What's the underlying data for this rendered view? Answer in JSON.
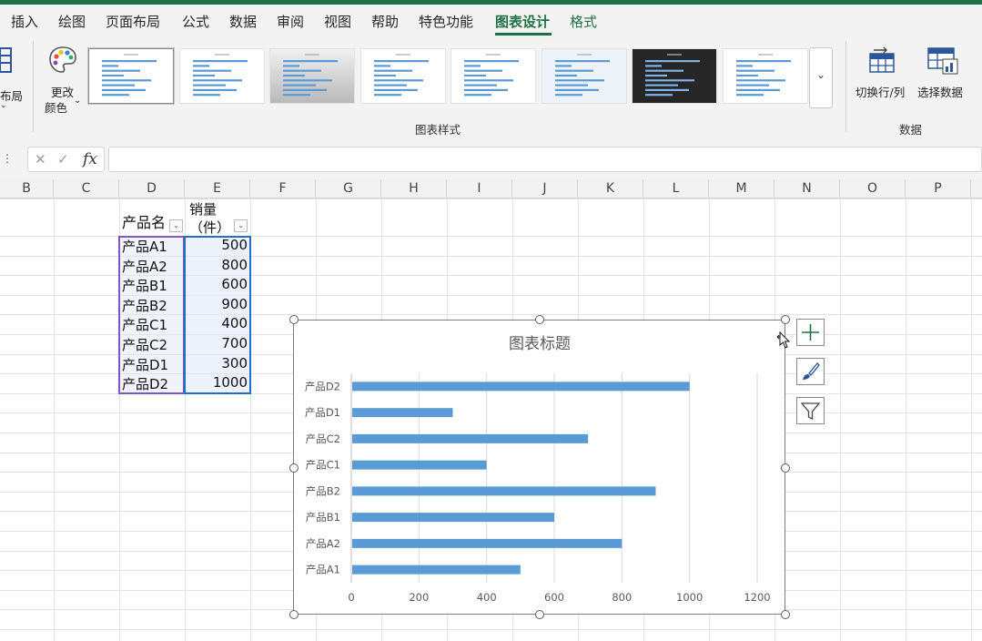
{
  "ribbon_tabs": [
    {
      "label": "插入",
      "state": "normal"
    },
    {
      "label": "绘图",
      "state": "normal"
    },
    {
      "label": "页面布局",
      "state": "normal"
    },
    {
      "label": "公式",
      "state": "normal"
    },
    {
      "label": "数据",
      "state": "normal"
    },
    {
      "label": "审阅",
      "state": "normal"
    },
    {
      "label": "视图",
      "state": "normal"
    },
    {
      "label": "帮助",
      "state": "normal"
    },
    {
      "label": "特色功能",
      "state": "normal"
    },
    {
      "label": "图表设计",
      "state": "active"
    },
    {
      "label": "格式",
      "state": "contextual"
    }
  ],
  "ribbon": {
    "layout_label": "布局",
    "change_colors_line1": "更改",
    "change_colors_line2": "颜色",
    "styles_group_label": "图表样式",
    "switch_row_col_label": "切换行/列",
    "select_data_label": "选择数据",
    "data_group_label": "数据",
    "gallery_count": 8,
    "selected_style_index": 0
  },
  "formula_bar": {
    "cancel_glyph": "✕",
    "enter_glyph": "✓",
    "fx_label": "fx",
    "value": ""
  },
  "columns": [
    "B",
    "C",
    "D",
    "E",
    "F",
    "G",
    "H",
    "I",
    "J",
    "K",
    "L",
    "M",
    "N",
    "O",
    "P"
  ],
  "table": {
    "header_product": "产品名",
    "header_sales_line1": "销量",
    "header_sales_line2": "（件）",
    "rows": [
      {
        "product": "产品A1",
        "sales": "500"
      },
      {
        "product": "产品A2",
        "sales": "800"
      },
      {
        "product": "产品B1",
        "sales": "600"
      },
      {
        "product": "产品B2",
        "sales": "900"
      },
      {
        "product": "产品C1",
        "sales": "400"
      },
      {
        "product": "产品C2",
        "sales": "700"
      },
      {
        "product": "产品D1",
        "sales": "300"
      },
      {
        "product": "产品D2",
        "sales": "1000"
      }
    ]
  },
  "chart_data": {
    "type": "bar",
    "orientation": "horizontal",
    "title": "图表标题",
    "categories": [
      "产品A1",
      "产品A2",
      "产品B1",
      "产品B2",
      "产品C1",
      "产品C2",
      "产品D1",
      "产品D2"
    ],
    "values": [
      500,
      800,
      600,
      900,
      400,
      700,
      300,
      1000
    ],
    "xlim": [
      0,
      1200
    ],
    "xticks": [
      0,
      200,
      400,
      600,
      800,
      1000,
      1200
    ],
    "grid": true,
    "bar_color": "#5b9bd5"
  },
  "colors": {
    "accent_green": "#1e7145",
    "selection_purple": "#7e57c2",
    "selection_blue": "#1f6fc5"
  },
  "chart_side_buttons": [
    "plus-icon",
    "brush-icon",
    "filter-icon"
  ]
}
